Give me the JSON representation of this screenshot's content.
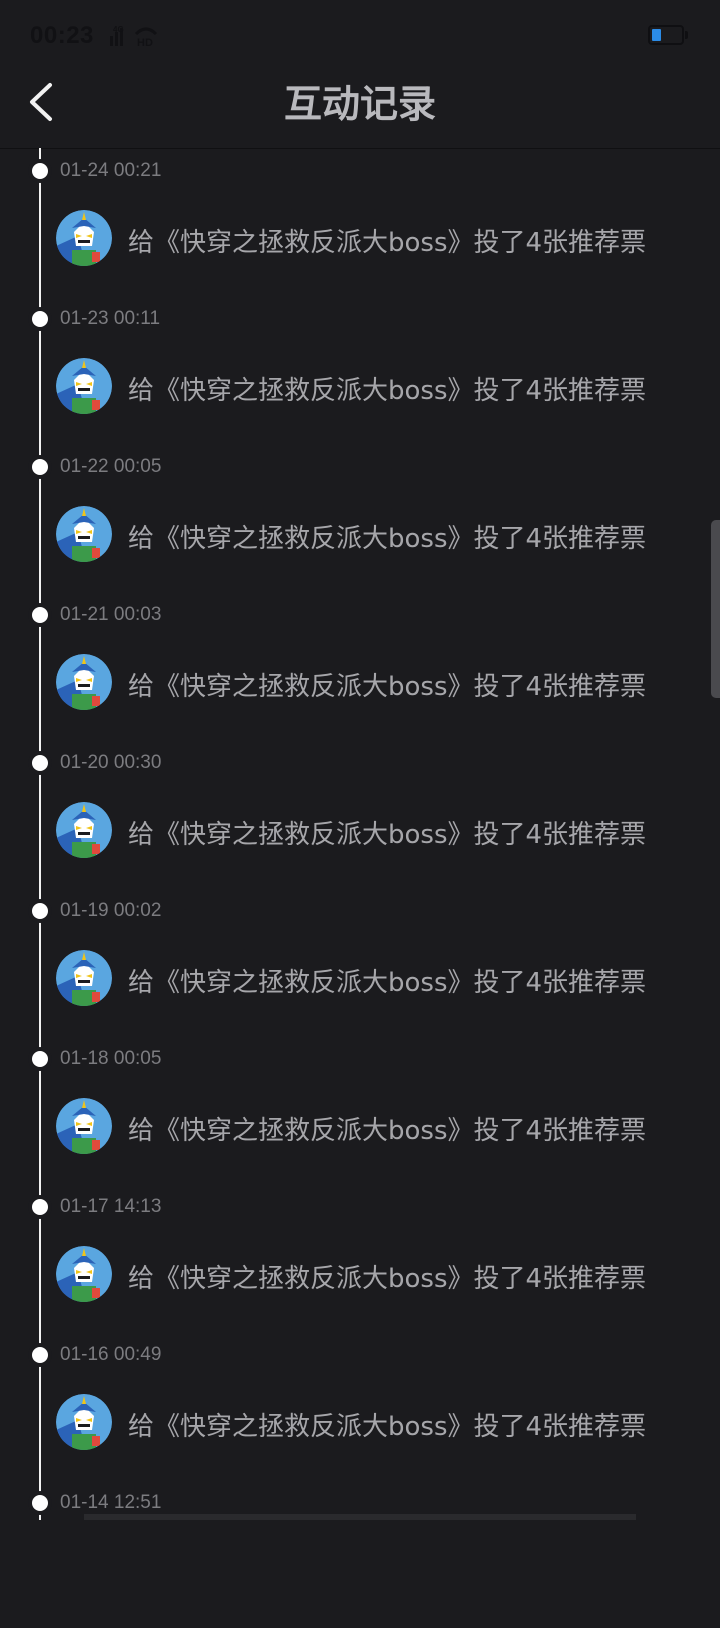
{
  "status_bar": {
    "time": "00:23",
    "battery_color": "#2b8be6"
  },
  "header": {
    "title": "互动记录",
    "back_icon": "chevron-left-icon"
  },
  "records": [
    {
      "time": "01-24 00:21",
      "text": "给《快穿之拯救反派大boss》投了4张推荐票"
    },
    {
      "time": "01-23 00:11",
      "text": "给《快穿之拯救反派大boss》投了4张推荐票"
    },
    {
      "time": "01-22 00:05",
      "text": "给《快穿之拯救反派大boss》投了4张推荐票"
    },
    {
      "time": "01-21 00:03",
      "text": "给《快穿之拯救反派大boss》投了4张推荐票"
    },
    {
      "time": "01-20 00:30",
      "text": "给《快穿之拯救反派大boss》投了4张推荐票"
    },
    {
      "time": "01-19 00:02",
      "text": "给《快穿之拯救反派大boss》投了4张推荐票"
    },
    {
      "time": "01-18 00:05",
      "text": "给《快穿之拯救反派大boss》投了4张推荐票"
    },
    {
      "time": "01-17 14:13",
      "text": "给《快穿之拯救反派大boss》投了4张推荐票"
    },
    {
      "time": "01-16 00:49",
      "text": "给《快穿之拯救反派大boss》投了4张推荐票"
    },
    {
      "time": "01-14 12:51",
      "text": ""
    }
  ],
  "colors": {
    "background": "#1b1b1e",
    "timeline": "#f2f2f2",
    "text": "#a6a6aa",
    "time": "#7c7c80"
  }
}
